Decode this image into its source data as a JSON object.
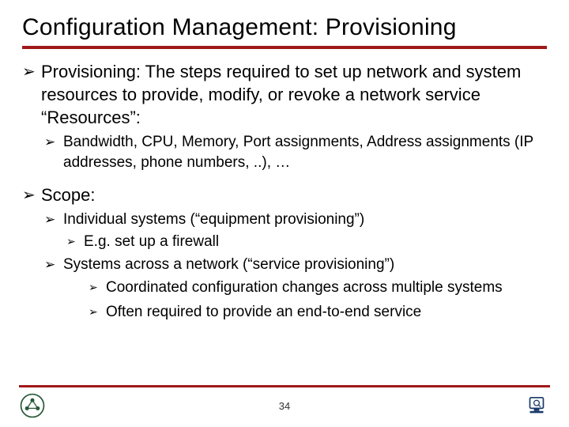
{
  "title": "Configuration Management: Provisioning",
  "bullets": {
    "b1": "Provisioning: The steps required to set up network and system resources to provide, modify, or revoke a network service “Resources”:",
    "b1a": " Bandwidth,  CPU, Memory, Port assignments, Address assignments (IP addresses, phone numbers, ..), …",
    "b2": "Scope:",
    "b2a": "Individual systems (“equipment provisioning”)",
    "b2a1": "E.g. set up a firewall",
    "b2b": "Systems across a network (“service provisioning”)",
    "b2b1": "Coordinated configuration changes across multiple systems",
    "b2b2": "Often required to provide an end-to-end service"
  },
  "glyphs": {
    "arrow": "➢"
  },
  "footer": {
    "page": "34"
  }
}
